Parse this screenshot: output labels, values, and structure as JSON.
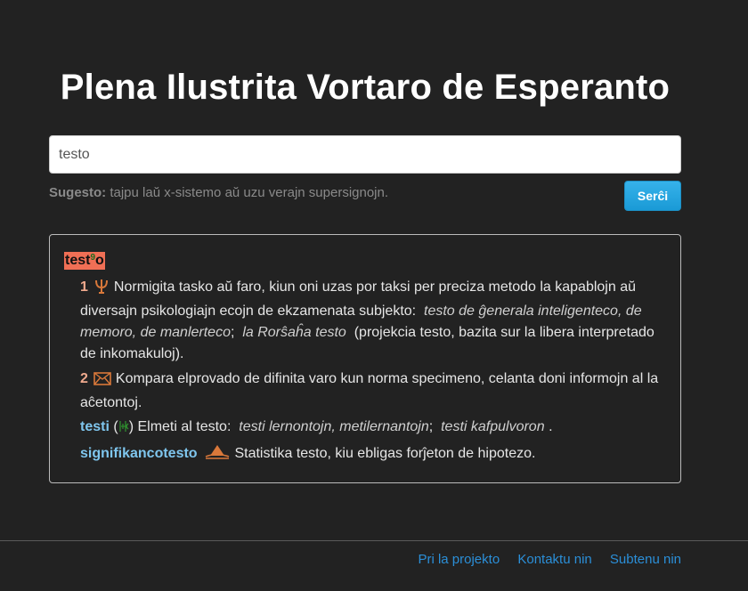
{
  "header": {
    "title": "Plena Ilustrita Vortaro de Esperanto"
  },
  "search": {
    "value": "testo",
    "hint_label": "Sugesto:",
    "hint_text": "tajpu laŭ x-sistemo aŭ uzu verajn supersignojn.",
    "button_label": "Serĉi"
  },
  "article": {
    "headword_root": "test",
    "headword_sup": "9",
    "headword_end": "o",
    "senses": [
      {
        "number": "1",
        "icon": "psi-icon",
        "text": "Normigita tasko aŭ faro, kiun oni uzas por taksi per preciza metodo la kapablojn aŭ diversajn psikologiajn ecojn de ekzamenata subjekto:",
        "example1": "testo de ĝenerala inteligenteco, de memoro, de manlerteco",
        "sep": ";",
        "example2": "la Rorŝaĥa testo",
        "note": "(projekcia testo, bazita sur la libera interpretado de inkomakuloj)."
      },
      {
        "number": "2",
        "icon": "envelope-icon",
        "text": "Kompara elprovado de difinita varo kun norma specimeno, celanta doni informojn al la aĉetontoj."
      }
    ],
    "derivatives": [
      {
        "word": "testi",
        "paren_open": "(",
        "paren_close": ")",
        "text": "Elmeti al testo:",
        "example1": "testi lernontojn, metilernantojn",
        "sep": ";",
        "example2": "testi kafpulvoron",
        "end": "."
      },
      {
        "word": "signifikancotesto",
        "icon": "statistics-icon",
        "text": "Statistika testo, kiu ebligas forĵeton de hipotezo."
      }
    ]
  },
  "footer": {
    "links": [
      "Pri la projekto",
      "Kontaktu nin",
      "Subtenu nin"
    ]
  },
  "colors": {
    "background": "#222222",
    "accent": "#1a9ad6",
    "headword_bg": "#f06f55",
    "derivative": "#7fc6ee",
    "link": "#2b8fd8"
  }
}
